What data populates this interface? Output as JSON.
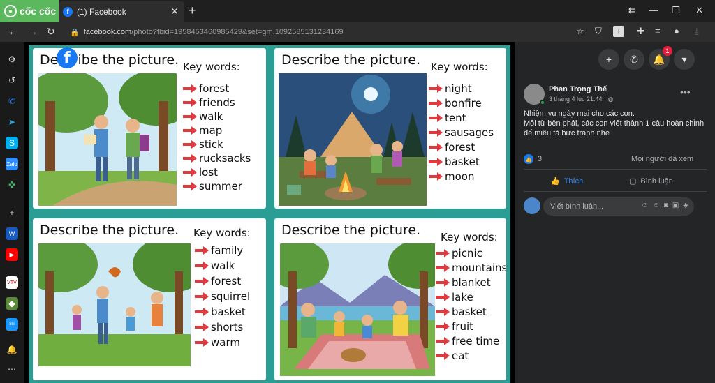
{
  "browser": {
    "brand": "cốc cốc",
    "tab_title": "(1) Facebook",
    "url_host": "facebook.com",
    "url_path": "/photo?fbid=1958453460985429&set=gm.1092585131234169"
  },
  "worksheet": {
    "cards": [
      {
        "title": "Describe the picture.",
        "kw_title": "Key words:",
        "words": [
          "forest",
          "friends",
          "walk",
          "map",
          "stick",
          "rucksacks",
          "lost",
          "summer"
        ]
      },
      {
        "title": "Describe the picture.",
        "kw_title": "Key words:",
        "words": [
          "night",
          "bonfire",
          "tent",
          "sausages",
          "forest",
          "basket",
          "moon"
        ]
      },
      {
        "title": "Describe the picture.",
        "kw_title": "Key words:",
        "words": [
          "family",
          "walk",
          "forest",
          "squirrel",
          "basket",
          "shorts",
          "warm"
        ]
      },
      {
        "title": "Describe the picture.",
        "kw_title": "Key words:",
        "words": [
          "picnic",
          "mountains",
          "blanket",
          "lake",
          "basket",
          "fruit",
          "free time",
          "eat"
        ]
      }
    ],
    "arrow_color": "#e03a3e",
    "board_color": "#2a9d94"
  },
  "post": {
    "author": "Phan Trọng Thế",
    "time": "3 tháng 4 lúc 21:44 · ",
    "line1": "Nhiệm vụ ngày mai cho các con.",
    "line2": "Mỗi từ bên phải, các con viết thành 1 câu hoàn chỉnh để miêu tả bức tranh nhé",
    "like_count": "3",
    "seen_by": "Mọi người đã xem",
    "like_label": "Thích",
    "comment_label": "Bình luận",
    "comment_placeholder": "Viết bình luận..."
  },
  "notifications_count": "1"
}
